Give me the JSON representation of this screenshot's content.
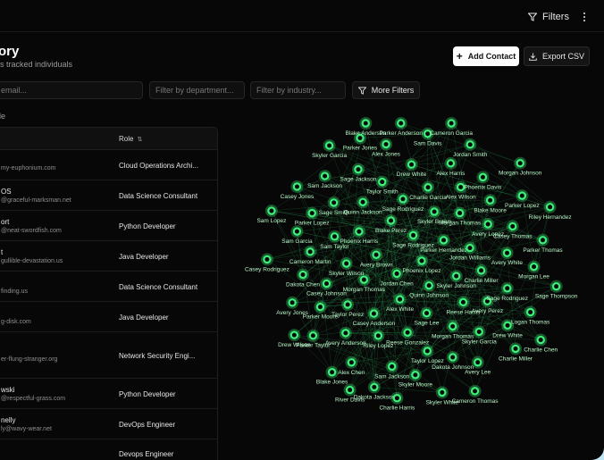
{
  "topbar": {
    "filters_label": "Filters"
  },
  "header": {
    "title": "ory",
    "subtitle": "s tracked individuals"
  },
  "actions": {
    "add_contact": "Add Contact",
    "export_csv": "Export CSV"
  },
  "filters": {
    "search_placeholder": "email...",
    "department_placeholder": "Filter by department...",
    "industry_placeholder": "Filter by industry...",
    "more_filters": "More Filters"
  },
  "view_label": "le",
  "table": {
    "role_header": "Role",
    "rows": [
      {
        "name": "",
        "email": "my-euphonium.com",
        "role": "Cloud Operations Archi..."
      },
      {
        "name": "OS",
        "email": "@graceful-marksman.net",
        "role": "Data Science Consultant"
      },
      {
        "name": "ort",
        "email": "@neat-swordfish.com",
        "role": "Python Developer"
      },
      {
        "name": "t",
        "email": "gullible-devastation.us",
        "role": "Java Developer"
      },
      {
        "name": "",
        "email": "finding.us",
        "role": "Data Science Consultant"
      },
      {
        "name": "",
        "email": "g-disk.com",
        "role": "Java Developer"
      },
      {
        "name": "",
        "email": "er-flung-stranger.org",
        "role": "Network Security Engi..."
      },
      {
        "name": "wski",
        "email": "@respectful-grass.com",
        "role": "Python Developer"
      },
      {
        "name": "nelly",
        "email": "ly@wavy-wear.net",
        "role": "DevOps Engineer"
      },
      {
        "name": "",
        "email": "",
        "role": "Devops Engineer"
      }
    ]
  },
  "graph": {
    "accent": "#3cf07a",
    "node_labels": [
      "Phoenix Lopez",
      "Jordan Chen",
      "Sage Rodriguez",
      "Quinn Johnson",
      "Avery Brown",
      "Parker Hernandez",
      "Alex White",
      "Blake Perez",
      "Skyler Johnson",
      "Morgan Thomas",
      "Skyler Brown",
      "Sage Lee",
      "Phoenix Harris",
      "Jordan Williams",
      "Casey Anderson",
      "Sage Rodriguez",
      "Reese Harris",
      "Skyler Wilson",
      "Morgan Thomas",
      "Reese Gonzalez",
      "Quinn Jackson",
      "Charlie Miller",
      "Taylor Perez",
      "Charlie Garcia",
      "Morgan Thomas",
      "Sam Taylor",
      "Avery Lopez",
      "Riley Lopez",
      "Taylor Smith",
      "Avery Perez",
      "Casey Johnson",
      "Alex Wilson",
      "Taylor Lopez",
      "Sage Smith",
      "Avery White",
      "Avery Anderson",
      "Drew White",
      "Skyler Garcia",
      "Cameron Martin",
      "Blake Moore",
      "Sam Jackson",
      "Sage Jackson",
      "Sage Rodriguez",
      "Parker Moore",
      "Alex Harris",
      "Dakota Johnson",
      "Parker Lopez",
      "Casey Thomas",
      "Alex Chen",
      "Alex Jones",
      "Drew White",
      "Dakota Chen",
      "Phoenix Davis",
      "Skyler Moore",
      "Sam Jackson",
      "Morgan Lee",
      "Parker Taylor",
      "Sam Davis",
      "Avery Lee",
      "Sam Garcia",
      "Parker Lopez",
      "Dakota Jackson",
      "Parker Jones",
      "Logan Thomas",
      "Avery Jones",
      "Jordan Smith",
      "Skyler White",
      "Casey Jones",
      "Parker Thomas",
      "Blake Jones",
      "Parker Anderson",
      "Charlie Miller",
      "Casey Rodriguez",
      "Morgan Johnson",
      "Charlie Harris",
      "Skyler Garcia",
      "Sage Thompson",
      "Drew Wilson",
      "Cameron Garcia",
      "Cameron Thomas",
      "Sam Lopez",
      "Riley Hernandez",
      "River Davis",
      "Blake Anderson",
      "Charlie Chen"
    ]
  }
}
